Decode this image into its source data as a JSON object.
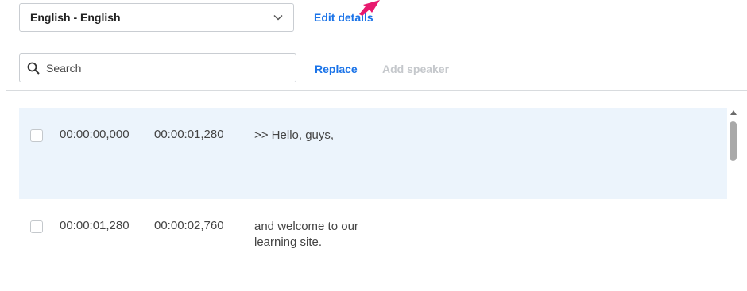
{
  "language_select": {
    "value": "English - English",
    "icon": "chevron-down-icon"
  },
  "edit_details_label": "Edit details",
  "search": {
    "placeholder": "Search",
    "value": "",
    "icon": "search-icon"
  },
  "actions": {
    "replace_label": "Replace",
    "add_speaker_label": "Add speaker"
  },
  "captions": [
    {
      "start": "00:00:00,000",
      "end": "00:00:01,280",
      "text": ">> Hello, guys,",
      "selected": true,
      "checked": false
    },
    {
      "start": "00:00:01,280",
      "end": "00:00:02,760",
      "text": "and welcome to our learning site.",
      "selected": false,
      "checked": false
    }
  ],
  "colors": {
    "link": "#1a73e8",
    "disabled_link": "#c5c8cc",
    "selected_row": "#ecf4fc",
    "annotation_arrow": "#e8196e"
  }
}
